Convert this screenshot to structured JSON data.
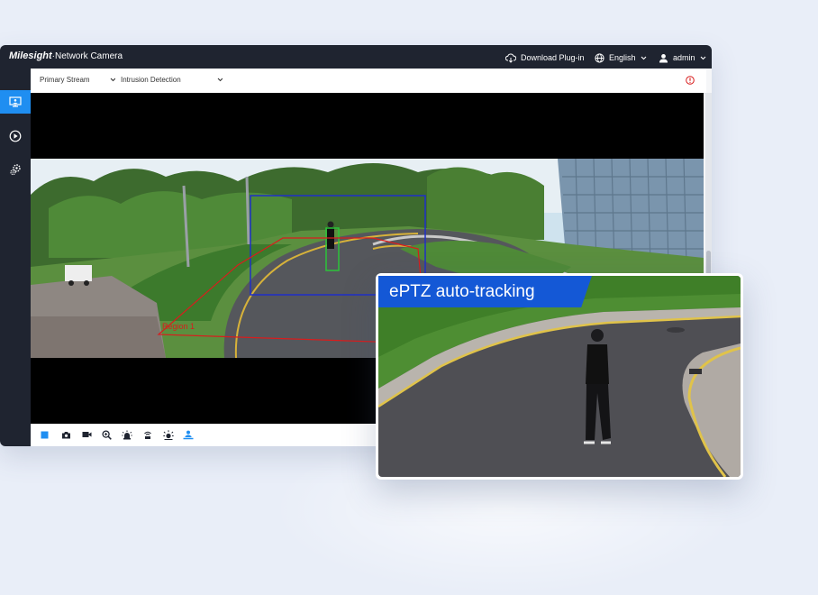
{
  "header": {
    "logo": "Milesight",
    "product": "·Network Camera",
    "download_label": "Download Plug-in",
    "language_label": "English",
    "user_label": "admin"
  },
  "sidebar": {
    "items": [
      {
        "icon": "monitor-icon",
        "active": true
      },
      {
        "icon": "play-circle-icon",
        "active": false
      },
      {
        "icon": "settings-gear-icon",
        "active": false
      }
    ]
  },
  "toolbar": {
    "stream_select": "Primary Stream",
    "detection_select": "Intrusion Detection"
  },
  "video": {
    "region_label": "Region 1"
  },
  "controls": {
    "icons": [
      "stop-icon",
      "snapshot-camera-icon",
      "record-video-icon",
      "zoom-icon",
      "alarm-light-icon",
      "ir-light-icon",
      "light-icon",
      "person-tracking-icon"
    ]
  },
  "overlay": {
    "tag_text": "ePTZ auto-tracking"
  },
  "colors": {
    "accent": "#1f8ef1",
    "header": "#1f2430",
    "tag": "#1458d6",
    "region": "#d81d1d",
    "tracking_box": "#1f2fc8",
    "person_box": "#2cc33a"
  }
}
